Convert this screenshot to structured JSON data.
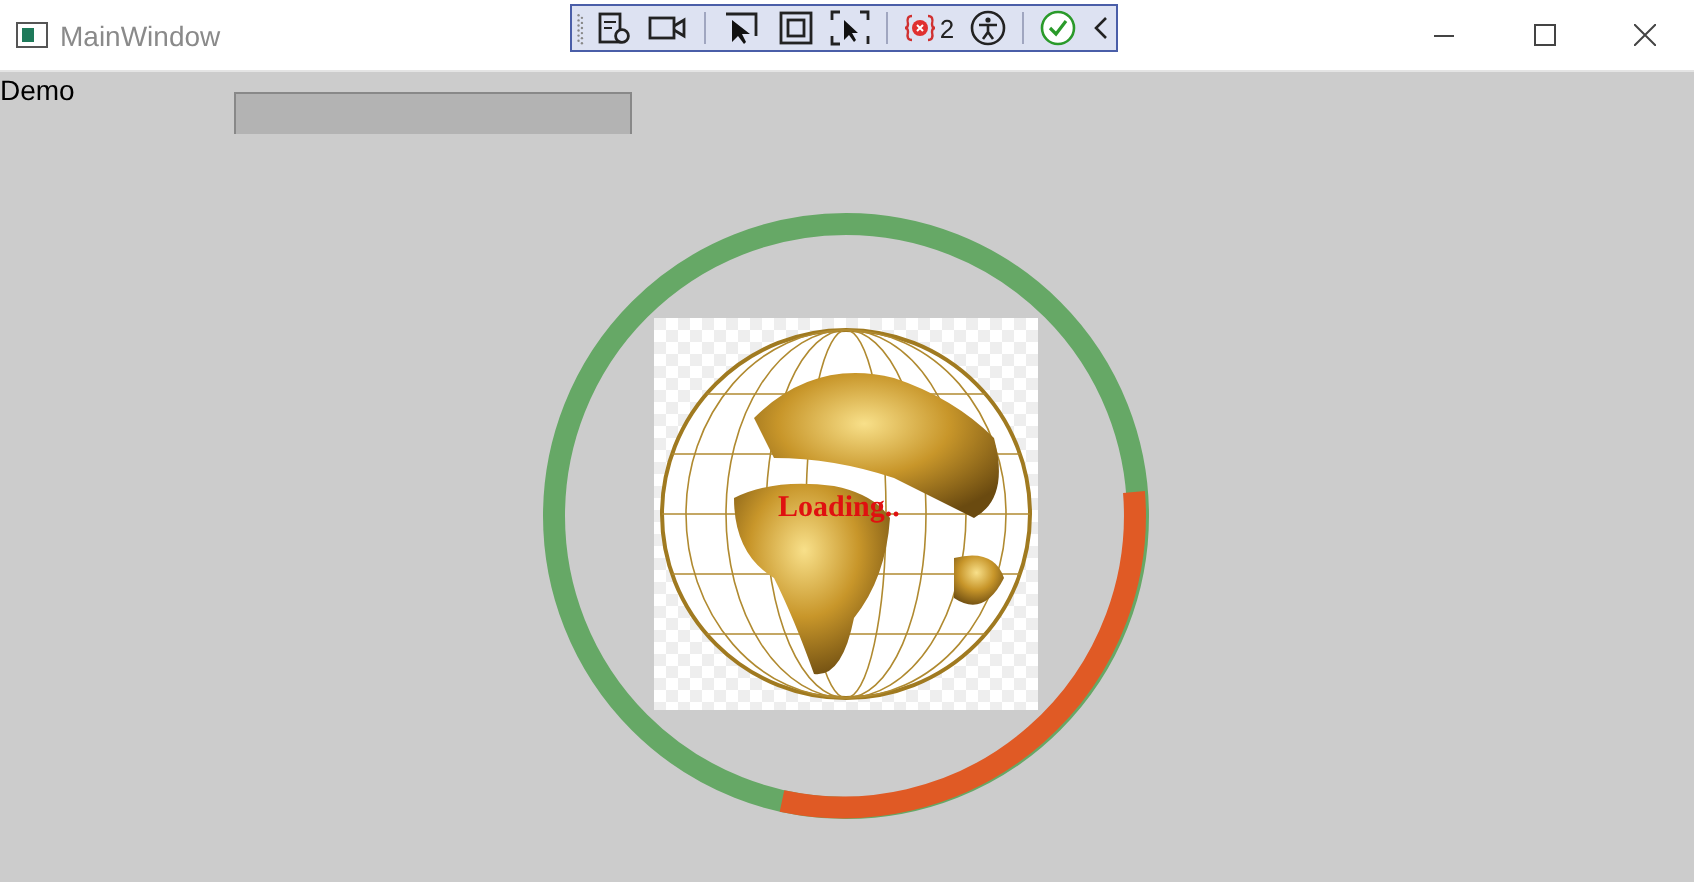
{
  "window": {
    "title": "MainWindow"
  },
  "debug_toolbar": {
    "binding_error_count": "2"
  },
  "content": {
    "label": "Demo",
    "loading_text": "Loading.."
  }
}
